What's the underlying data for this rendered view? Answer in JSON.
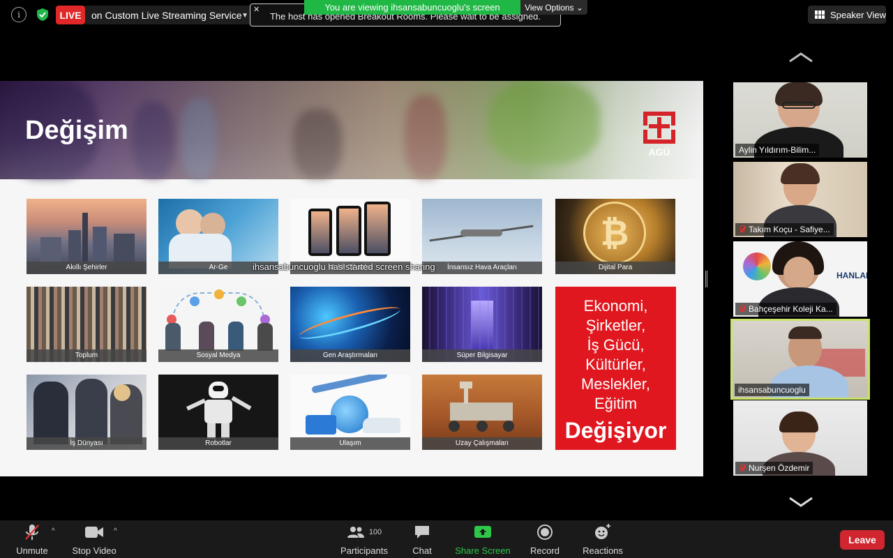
{
  "topbar": {
    "live_badge": "LIVE",
    "live_service": "on Custom Live Streaming Service",
    "notice_text": "The host has opened Breakout Rooms. Please wait to be assigned.",
    "viewing_banner": "You are viewing ihsansabuncuoglu's screen",
    "view_options": "View Options ⌄",
    "speaker_view": "Speaker View"
  },
  "slide": {
    "title": "Değişim",
    "logo_text": "AGÜ",
    "sharing_overlay": "ihsansabuncuoglu has started screen sharing",
    "tiles": [
      {
        "label": "Akıllı Şehirler"
      },
      {
        "label": "Ar-Ge"
      },
      {
        "label": "Mobil Cihazlar"
      },
      {
        "label": "İnsansız Hava Araçları"
      },
      {
        "label": "Dijital Para"
      },
      {
        "label": "Toplum"
      },
      {
        "label": "Sosyal Medya"
      },
      {
        "label": "Gen Araştırmaları"
      },
      {
        "label": "Süper Bilgisayar"
      },
      {
        "label": "İş Dünyası"
      },
      {
        "label": "Robotlar"
      },
      {
        "label": "Ulaşım"
      },
      {
        "label": "Uzay Çalışmaları"
      }
    ],
    "red_box": {
      "lines": [
        "Ekonomi,",
        "Şirketler,",
        "İş Gücü,",
        "Kültürler,",
        "Meslekler,",
        "Eğitim"
      ],
      "big": "Değişiyor"
    }
  },
  "participants": [
    {
      "name": "Aylin Yıldırım-Bilim...",
      "muted": false
    },
    {
      "name": "Takım Koçu - Safiye...",
      "muted": true
    },
    {
      "name": "Bahçeşehir Koleji Ka...",
      "muted": true,
      "bg_text": "HANLARI"
    },
    {
      "name": "ihsansabuncuoglu",
      "muted": false,
      "active": true
    },
    {
      "name": "Nurşen Özdemir",
      "muted": true
    }
  ],
  "toolbar": {
    "unmute": "Unmute",
    "stop_video": "Stop Video",
    "participants": "Participants",
    "participants_count": "100",
    "chat": "Chat",
    "share_screen": "Share Screen",
    "record": "Record",
    "reactions": "Reactions",
    "leave": "Leave"
  },
  "colors": {
    "live": "#e02828",
    "banner_green": "#1fb845",
    "share_green": "#2ec74a",
    "active_speaker": "#c9e36a",
    "leave": "#d0262f",
    "slide_red": "#e0171f"
  }
}
